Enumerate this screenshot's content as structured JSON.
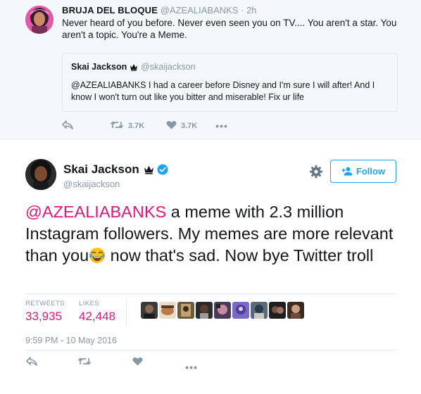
{
  "reply_tweet": {
    "author_name": "BRUJA DEL BLOQUE",
    "author_handle": "@AZEALIABANKS",
    "separator": "·",
    "time": "2h",
    "text": "Never heard of you before. Never even seen you on TV.... You aren't a star. You aren't a topic. You're a Meme.",
    "quoted": {
      "author_name": "Skai Jackson",
      "author_handle": "@skaijackson",
      "text": "@AZEALIABANKS I had a career before Disney and I'm sure I will after! And I know I won't turn out like you bitter and miserable! Fix ur life"
    },
    "actions": {
      "retweet_count": "3.7K",
      "like_count": "3.7K"
    }
  },
  "main_tweet": {
    "author_name": "Skai Jackson",
    "author_handle": "@skaijackson",
    "follow_label": "Follow",
    "text_mention": "@AZEALIABANKS",
    "text_part1": " a meme with 2.3 million Instagram followers. My memes are more relevant than you",
    "emoji": "face-with-tears-of-joy",
    "text_part2": " now that's sad. Now bye Twitter troll",
    "stats": {
      "retweets_label": "RETWEETS",
      "retweets_value": "33,935",
      "likes_label": "LIKES",
      "likes_value": "42,448"
    },
    "liker_avatars_count": 9,
    "timestamp": "9:59 PM - 10 May 2016"
  },
  "colors": {
    "accent_blue": "#1da1f2",
    "mention_pink": "#e0177a",
    "muted": "#8899a6",
    "top_background": "#f5f8fa",
    "verified_blue": "#1da1f2"
  },
  "icons": [
    "reply-icon",
    "retweet-icon",
    "heart-icon",
    "more-icon",
    "crown-icon",
    "verified-badge-icon",
    "gear-icon",
    "add-user-icon"
  ]
}
